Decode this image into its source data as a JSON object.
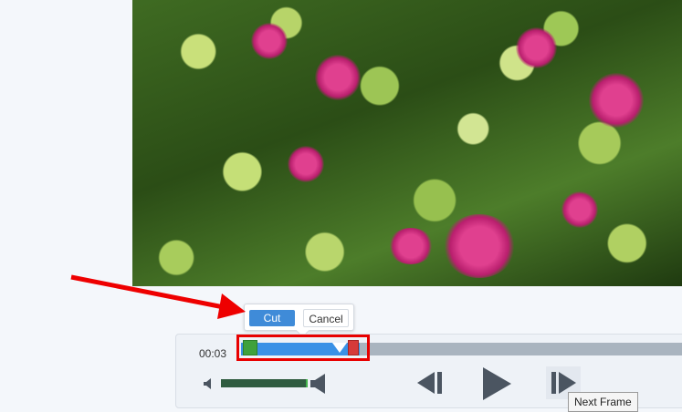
{
  "popup": {
    "cut_label": "Cut",
    "cancel_label": "Cancel"
  },
  "timeline": {
    "time": "00:03"
  },
  "tooltip": {
    "text": "Next Frame"
  },
  "colors": {
    "accent": "#3f8bd8",
    "selection": "#3a91e6",
    "highlight": "#e80000"
  },
  "icons": [
    "speaker-low-icon",
    "speaker-high-icon",
    "previous-frame-icon",
    "play-icon",
    "next-frame-icon",
    "arrow-annotation"
  ]
}
